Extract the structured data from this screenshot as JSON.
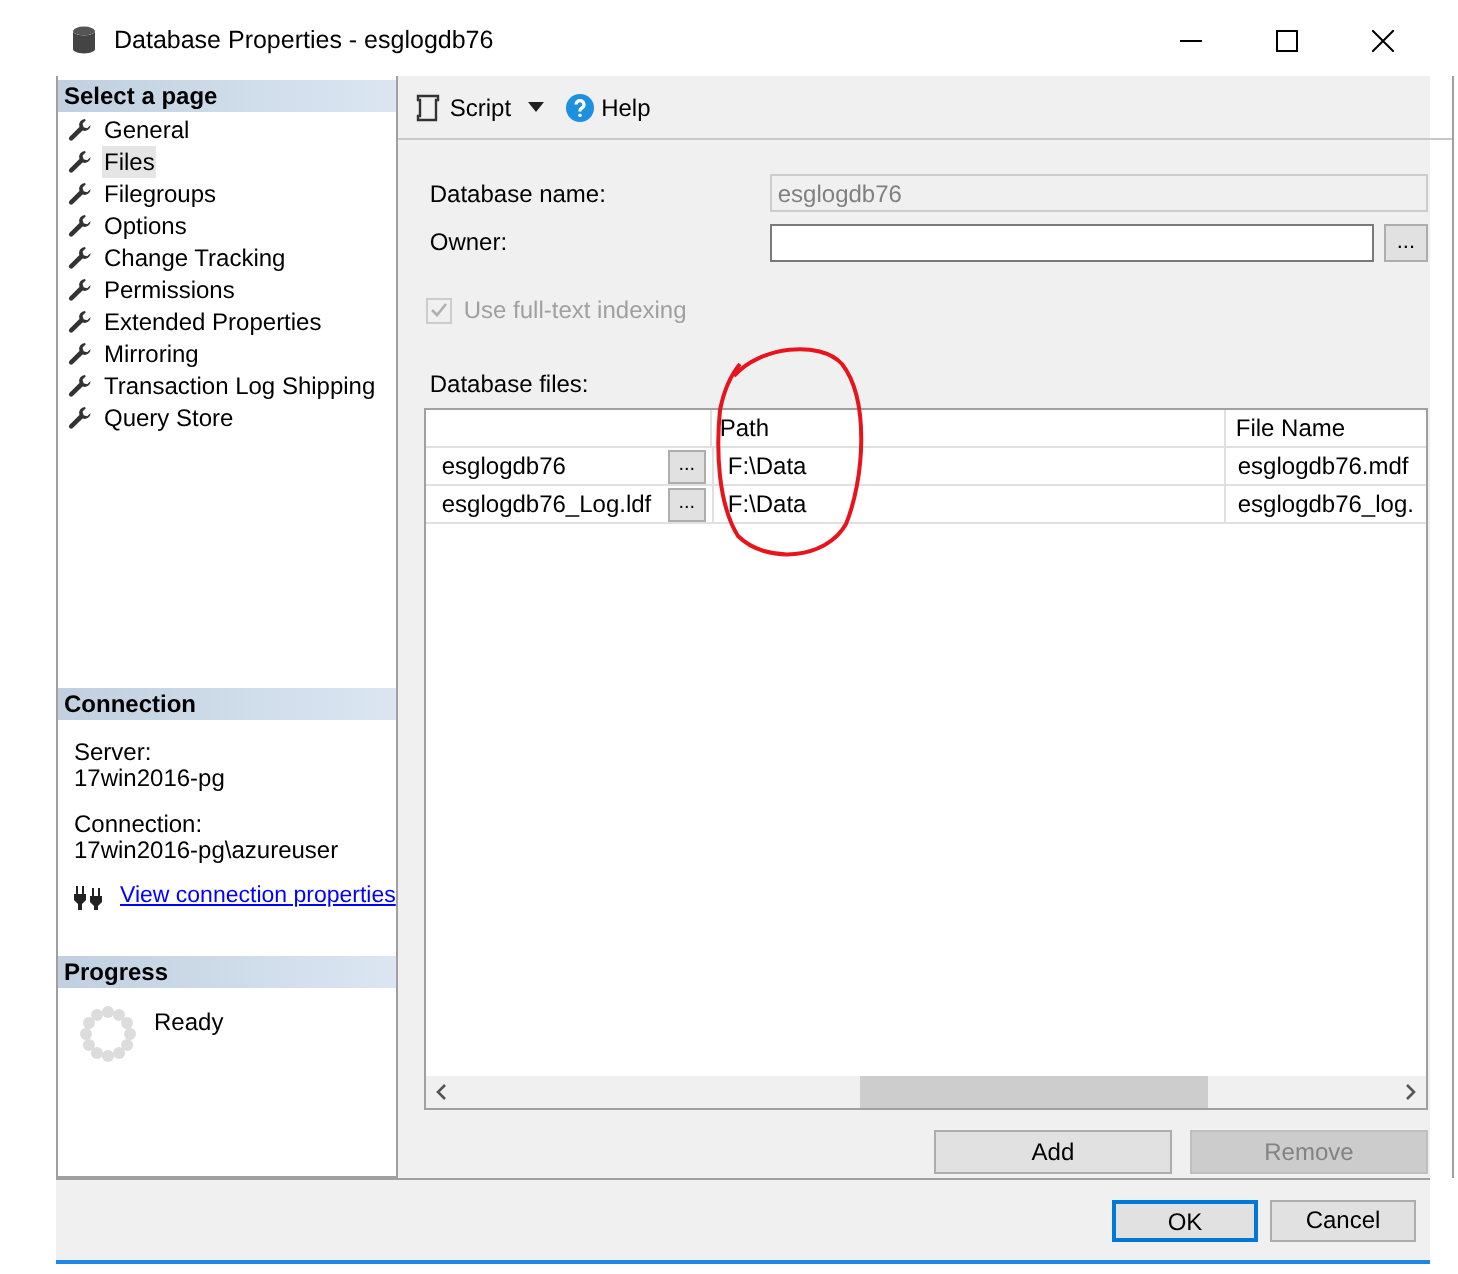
{
  "window": {
    "title": "Database Properties - esglogdb76"
  },
  "sidebar": {
    "title": "Select a page",
    "items": [
      {
        "label": "General",
        "selected": false
      },
      {
        "label": "Files",
        "selected": true
      },
      {
        "label": "Filegroups",
        "selected": false
      },
      {
        "label": "Options",
        "selected": false
      },
      {
        "label": "Change Tracking",
        "selected": false
      },
      {
        "label": "Permissions",
        "selected": false
      },
      {
        "label": "Extended Properties",
        "selected": false
      },
      {
        "label": "Mirroring",
        "selected": false
      },
      {
        "label": "Transaction Log Shipping",
        "selected": false
      },
      {
        "label": "Query Store",
        "selected": false
      }
    ]
  },
  "connection": {
    "title": "Connection",
    "server_label": "Server:",
    "server": "17win2016-pg",
    "connection_label": "Connection:",
    "connection": "17win2016-pg\\azureuser",
    "link": "View connection properties"
  },
  "progress": {
    "title": "Progress",
    "status": "Ready"
  },
  "toolbar": {
    "script": "Script",
    "help": "Help"
  },
  "form": {
    "database_name": {
      "label": "Database name:",
      "value": "esglogdb76",
      "disabled": true
    },
    "owner": {
      "label": "Owner:",
      "browse": "..."
    },
    "fulltext": {
      "label": "Use full-text indexing",
      "checked": true,
      "disabled": true
    }
  },
  "files": {
    "label": "Database files:",
    "columns": [
      "Path",
      "File Name"
    ],
    "rows": [
      {
        "name": "esglogdb76",
        "browse": "...",
        "path": "F:\\Data",
        "file_name": "esglogdb76.mdf"
      },
      {
        "name": "esglogdb76_Log.ldf",
        "browse": "...",
        "path": "F:\\Data",
        "file_name": "esglogdb76_log."
      }
    ]
  },
  "actions": [
    {
      "label": "Add",
      "disabled": false
    },
    {
      "label": "Remove",
      "disabled": true
    }
  ],
  "buttons": [
    {
      "label": "OK",
      "default": true
    },
    {
      "label": "Cancel",
      "default": false
    }
  ]
}
